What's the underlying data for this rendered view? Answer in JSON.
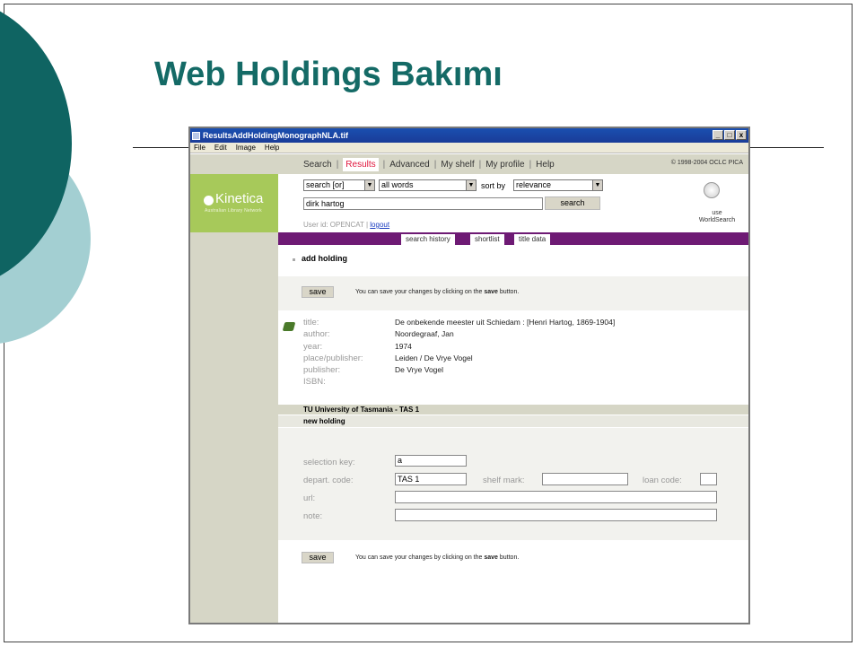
{
  "slide": {
    "title": "Web Holdings Bakımı"
  },
  "window": {
    "title": "ResultsAddHoldingMonographNLA.tif",
    "minimize": "_",
    "maximize": "□",
    "close": "x",
    "menu": [
      "File",
      "Edit",
      "Image",
      "Help"
    ]
  },
  "logo": {
    "name": "Kinetica",
    "tagline": "Australian Library Network"
  },
  "nav": {
    "items": [
      "Search",
      "Results",
      "Advanced",
      "My shelf",
      "My profile",
      "Help"
    ],
    "active": "Results",
    "copyright": "© 1998-2004 OCLC PICA"
  },
  "search": {
    "mode": "search [or]",
    "words": "all words",
    "sort_label": "sort by",
    "sort": "relevance",
    "query": "dirk hartog",
    "button": "search",
    "user_prefix": "User id: OPENCAT |",
    "logout": "logout",
    "worldsearch_line1": "use",
    "worldsearch_line2": "WorldSearch"
  },
  "tabs": [
    "search history",
    "shortlist",
    "title data"
  ],
  "add_holding": {
    "label": "add holding",
    "save_button": "save",
    "save_msg_before": "You can save your changes by clicking on the",
    "save_msg_bold": "save",
    "save_msg_after": "button."
  },
  "record": {
    "labels": [
      "title:",
      "author:",
      "year:",
      "place/publisher:",
      "publisher:",
      "ISBN:"
    ],
    "values": [
      "De onbekende meester uit Schiedam : [Henri Hartog, 1869-1904]",
      "Noordegraaf, Jan",
      "1974",
      "Leiden / De Vrye Vogel",
      "De Vrye Vogel",
      ""
    ]
  },
  "library": {
    "name": "TU University of Tasmania - TAS 1",
    "new_holding": "new holding"
  },
  "form": {
    "selection_key_label": "selection key:",
    "selection_key": "a",
    "depart_code_label": "depart. code:",
    "depart_code": "TAS 1",
    "shelf_mark_label": "shelf mark:",
    "shelf_mark": "",
    "loan_code_label": "loan code:",
    "loan_code": "",
    "url_label": "url:",
    "url": "",
    "note_label": "note:",
    "note": ""
  }
}
